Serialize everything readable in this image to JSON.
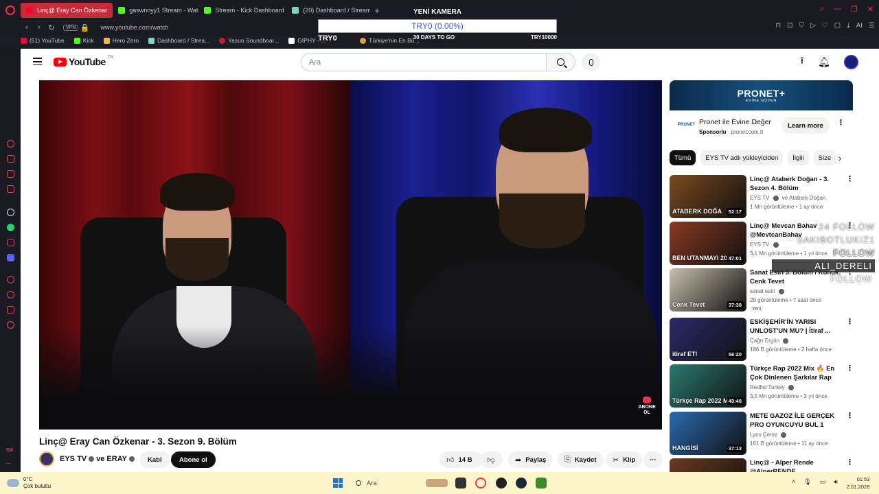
{
  "browser": {
    "tabs": [
      {
        "label": "Linç@ Eray Can Özkenar",
        "active": true,
        "color": "#ff0033"
      },
      {
        "label": "gaswnnyy1 Stream - Watc",
        "active": false,
        "color": "#53fc18"
      },
      {
        "label": "Stream - Kick Dashboard",
        "active": false,
        "color": "#53fc18"
      },
      {
        "label": "(20) Dashboard / Streamla",
        "active": false,
        "color": "#7fd1c4"
      }
    ],
    "new_tab": "+",
    "vpn": "VPN",
    "url": "www.youtube.com/watch",
    "bookmarks": [
      {
        "label": "(51) YouTube",
        "color": "#ff0033"
      },
      {
        "label": "Kick",
        "color": "#53fc18"
      },
      {
        "label": "Hero Zero",
        "color": "#f2b632"
      },
      {
        "label": "Dashboard / Strea...",
        "color": "#7fd1c4"
      },
      {
        "label": "Yasuo Soundboar...",
        "color": "#c02030"
      },
      {
        "label": "GIPHY - ...",
        "color": "#ffffff"
      },
      {
        "label": "Türkiye'nin En Bü...",
        "color": "#e0a030"
      }
    ],
    "right_ai": "AI"
  },
  "stream_widget": {
    "title": "YENİ KAMERA",
    "bar_text": "TRY0 (0.00%)",
    "left": "TRY0",
    "middle": "30 DAYS TO GO",
    "right": "TRY10000"
  },
  "youtube": {
    "logo_text": "YouTube",
    "region": "TR",
    "search_placeholder": "Ara",
    "video": {
      "title": "Linç@ Eray Can Özkenar - 3. Sezon 9. Bölüm",
      "overlay_badge_line1": "ABONE",
      "overlay_badge_line2": "OL"
    },
    "channel": {
      "name": "EYS TV",
      "with": "ve ERAY",
      "join": "Katıl",
      "subscribe": "Abone ol"
    },
    "actions": {
      "likes": "14 B",
      "share": "Paylaş",
      "save": "Kaydet",
      "clip": "Klip"
    },
    "ad": {
      "banner_brand": "PRONET+",
      "banner_tag": "EVİNE GÜVEN",
      "logo": "PRONET",
      "title": "Pronet ile Evine Değer",
      "sponsor": "Sponsorlu",
      "domain": "pronet.com.tr",
      "cta": "Learn more"
    },
    "chips": [
      "Tümü",
      "EYS TV adlı yükleyiciden",
      "İlgili",
      "Size"
    ],
    "recommendations": [
      {
        "title": "Linç@ Ataberk Doğan - 3. Sezon 4. Bölüm",
        "channel": "EYS TV",
        "channel_extra": "ve Ataberk Doğan",
        "meta": "1 Mn görüntüleme • 1 ay önce",
        "duration": "52:17",
        "caption": "ATABERK DOĞA",
        "badge": "",
        "thumb_color": "#7a4a20"
      },
      {
        "title": "Linç@ Mevcan Bahav @MevtcanBahav",
        "channel": "EYS TV",
        "channel_extra": "",
        "meta": "3,1 Mn görüntüleme • 1 yıl önce",
        "duration": "47:01",
        "caption": "BEN UTANMAYI 2010",
        "badge": "",
        "thumb_color": "#8a3a20"
      },
      {
        "title": "Sanat Esiri 3. Bölüm / Konuk: Cenk Tevet",
        "channel": "sanat esiri",
        "channel_extra": "",
        "meta": "29 görüntüleme • 7 saat önce",
        "duration": "37:38",
        "caption": "Cenk Tevet",
        "badge": "Yeni",
        "thumb_color": "#c8c0b0"
      },
      {
        "title": "ESKİŞEHİR'İN YARISI UNLOST'UN MU? | İtiraf ...",
        "channel": "Çağrı Ergün",
        "channel_extra": "",
        "meta": "186 B görüntüleme • 2 hafta önce",
        "duration": "56:20",
        "caption": "itiraf ET!",
        "badge": "",
        "thumb_color": "#2a2a6a"
      },
      {
        "title": "Türkçe Rap 2022 Mix 🔥 En Çok Dinlenen Şarkılar Rap 202...",
        "channel": "Redlist Turkey",
        "channel_extra": "",
        "meta": "3,5 Mn görüntüleme • 3 yıl önce",
        "duration": "43:48",
        "caption": "Türkçe Rap 2022 Mix",
        "badge": "",
        "thumb_color": "#2a7a70"
      },
      {
        "title": "METE GAZOZ İLE GERÇEK PRO OYUNCUYU BUL 1 GERÇEK 4 ...",
        "channel": "Lynx Çerez",
        "channel_extra": "",
        "meta": "161 B görüntüleme • 11 ay önce",
        "duration": "37:13",
        "caption": "HANGİSİ",
        "badge": "",
        "thumb_color": "#2a6ab0"
      },
      {
        "title": "Linç@ - Alper Rende @AlperRENDE",
        "channel": "",
        "channel_extra": "",
        "meta": "",
        "duration": "",
        "caption": "",
        "badge": "",
        "thumb_color": "#6a3a20"
      }
    ]
  },
  "follow_overlay": [
    {
      "name": "24",
      "label": "FOLLOW"
    },
    {
      "name": "SAKIBOTLUKIZ1",
      "label": "FOLLOW"
    },
    {
      "name": "",
      "label": "FOLLOW"
    },
    {
      "name": "ALI_DERELI",
      "label": "FOLLOW"
    }
  ],
  "taskbar": {
    "temp": "0°C",
    "weather": "Çok bulutlu",
    "search": "Ara",
    "time": "01:53",
    "date": "2.01.2026"
  }
}
